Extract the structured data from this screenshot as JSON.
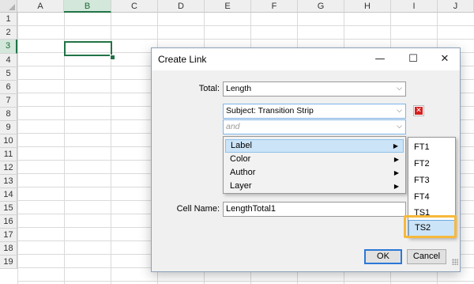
{
  "spreadsheet": {
    "columns": [
      "A",
      "B",
      "C",
      "D",
      "E",
      "F",
      "G",
      "H",
      "I",
      "J"
    ],
    "rows": [
      "1",
      "2",
      "3",
      "4",
      "5",
      "6",
      "7",
      "8",
      "9",
      "10",
      "11",
      "12",
      "13",
      "14",
      "15",
      "16",
      "17",
      "18",
      "19"
    ],
    "selected_column": "B",
    "selected_row": "3",
    "colors": {
      "selection": "#217346",
      "header_selected_bg": "#d3e7da"
    }
  },
  "dialog": {
    "title": "Create Link",
    "minimize_glyph": "—",
    "maximize_glyph": "☐",
    "close_glyph": "✕",
    "total_label": "Total:",
    "total_value": "Length",
    "subject_value": "Subject: Transition Strip",
    "and_placeholder": "and",
    "cell_name_label": "Cell Name:",
    "cell_name_value": "LengthTotal1",
    "ok_label": "OK",
    "cancel_label": "Cancel",
    "remove_icon": "delete-x-icon",
    "colors": {
      "accent": "#2b78d6",
      "remove": "#d42020"
    }
  },
  "context_menu": {
    "items": [
      {
        "label": "Label",
        "highlighted": true
      },
      {
        "label": "Color",
        "highlighted": false
      },
      {
        "label": "Author",
        "highlighted": false
      },
      {
        "label": "Layer",
        "highlighted": false
      }
    ]
  },
  "submenu": {
    "items": [
      {
        "label": "FT1",
        "highlighted": false
      },
      {
        "label": "FT2",
        "highlighted": false
      },
      {
        "label": "FT3",
        "highlighted": false
      },
      {
        "label": "FT4",
        "highlighted": false
      },
      {
        "label": "TS1",
        "highlighted": false
      },
      {
        "label": "TS2",
        "highlighted": true
      }
    ],
    "focus_color": "#f6b93b"
  }
}
